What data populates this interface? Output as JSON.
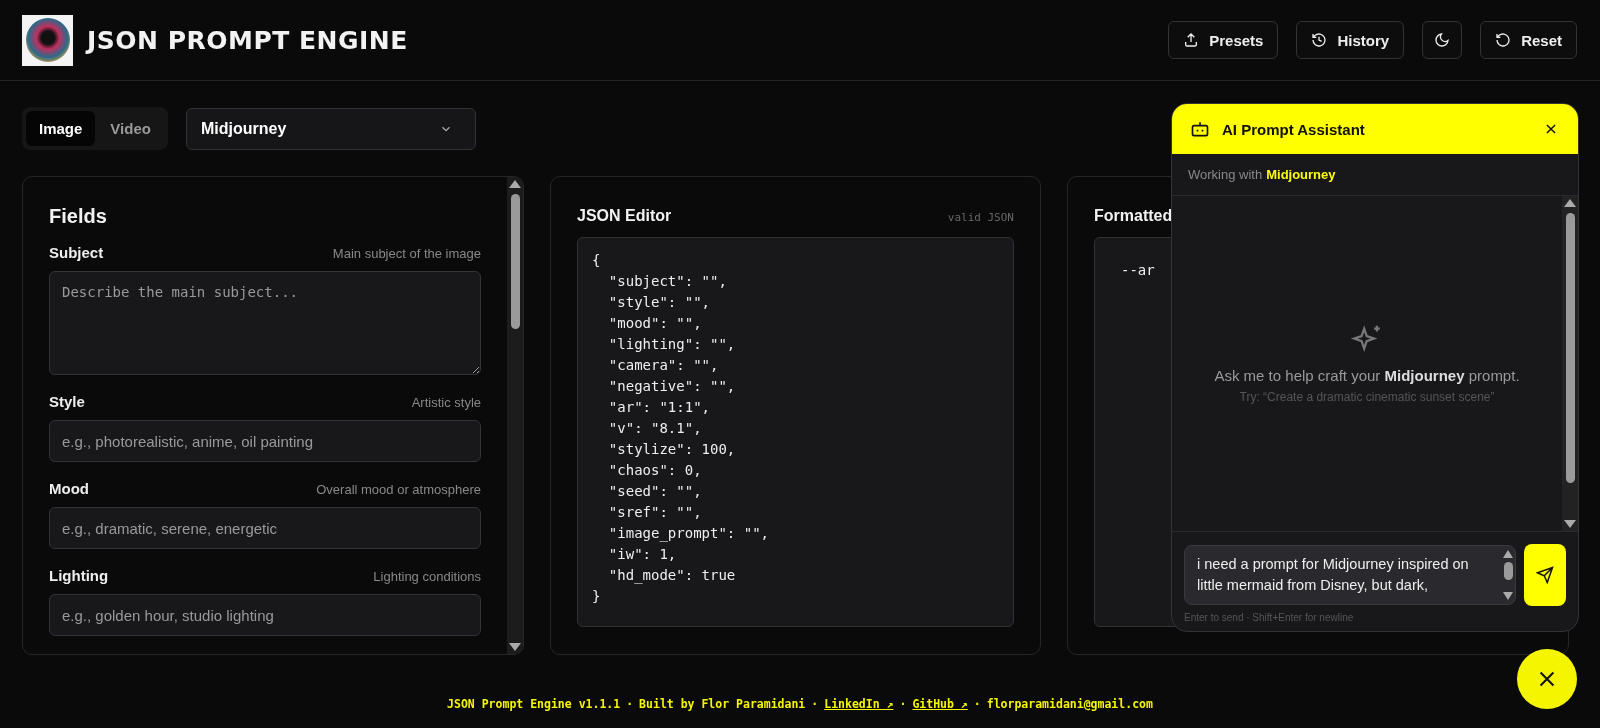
{
  "header": {
    "title": "JSON PROMPT ENGINE",
    "buttons": [
      {
        "kind": "presets",
        "label": "Presets"
      },
      {
        "kind": "history",
        "label": "History"
      },
      {
        "kind": "theme"
      },
      {
        "kind": "reset",
        "label": "Reset"
      }
    ]
  },
  "mode_tabs": [
    {
      "label": "Image",
      "selected": true
    },
    {
      "label": "Video",
      "selected": false
    }
  ],
  "model_select": {
    "value": "Midjourney"
  },
  "fields_panel": {
    "title": "Fields",
    "fields": [
      {
        "kind": "textarea",
        "label": "Subject",
        "hint": "Main subject of the image",
        "placeholder": "Describe the main subject..."
      },
      {
        "kind": "input",
        "label": "Style",
        "hint": "Artistic style",
        "placeholder": "e.g., photorealistic, anime, oil painting"
      },
      {
        "kind": "input",
        "label": "Mood",
        "hint": "Overall mood or atmosphere",
        "placeholder": "e.g., dramatic, serene, energetic"
      },
      {
        "kind": "input",
        "label": "Lighting",
        "hint": "Lighting conditions",
        "placeholder": "e.g., golden hour, studio lighting"
      }
    ]
  },
  "json_editor": {
    "title": "JSON Editor",
    "status": "valid JSON",
    "lines": [
      "{",
      "  \"subject\": \"\",",
      "  \"style\": \"\",",
      "  \"mood\": \"\",",
      "  \"lighting\": \"\",",
      "  \"camera\": \"\",",
      "  \"negative\": \"\",",
      "  \"ar\": \"1:1\",",
      "  \"v\": \"8.1\",",
      "  \"stylize\": 100,",
      "  \"chaos\": 0,",
      "  \"seed\": \"\",",
      "  \"sref\": \"\",",
      "  \"image_prompt\": \"\",",
      "  \"iw\": 1,",
      "  \"hd_mode\": true",
      "}"
    ]
  },
  "formatted_panel": {
    "title": "Formatted",
    "lines": [
      "--ar"
    ]
  },
  "assistant": {
    "title": "AI Prompt Assistant",
    "context_label": "Working with",
    "context_model": "Midjourney",
    "empty_message": "Ask me to help craft your **Midjourney** prompt.",
    "suggestion": "Try: “Create a dramatic cinematic sunset scene”",
    "input_value": "i need a prompt for Midjourney inspired on little mermaid from Disney, but dark,",
    "hint": "Enter to send · Shift+Enter for newline"
  },
  "footer": {
    "separator": "·",
    "items": [
      {
        "kind": "text",
        "text": "JSON Prompt Engine v1.1.1"
      },
      {
        "kind": "text",
        "text": "Built by Flor Paramidani"
      },
      {
        "kind": "link",
        "text": "LinkedIn ↗"
      },
      {
        "kind": "link",
        "text": "GitHub ↗"
      },
      {
        "kind": "text",
        "text": "florparamidani@gmail.com"
      }
    ]
  }
}
